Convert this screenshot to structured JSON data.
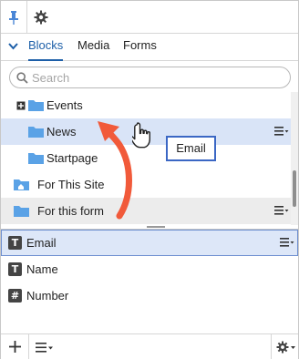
{
  "tabs": [
    {
      "label": "Blocks"
    },
    {
      "label": "Media"
    },
    {
      "label": "Forms"
    }
  ],
  "search": {
    "placeholder": "Search"
  },
  "tree": {
    "items": [
      {
        "label": "Events",
        "icon": "folder-icon",
        "expander": "plus-box-icon"
      },
      {
        "label": "News",
        "icon": "folder-icon"
      },
      {
        "label": "Startpage",
        "icon": "folder-icon"
      },
      {
        "label": "For This Site",
        "icon": "site-folder-icon"
      },
      {
        "label": "For this form",
        "icon": "folder-icon"
      }
    ]
  },
  "fields": {
    "items": [
      {
        "label": "Email",
        "icon": "text-field-icon",
        "glyph": "T"
      },
      {
        "label": "Name",
        "icon": "text-field-icon",
        "glyph": "T"
      },
      {
        "label": "Number",
        "icon": "number-field-icon",
        "glyph": "#"
      }
    ]
  },
  "drag_tooltip": {
    "label": "Email"
  },
  "colors": {
    "accent": "#1d5fa8",
    "folder": "#5aa2e6",
    "selection": "#d9e4f7",
    "arrow": "#f15a3a"
  }
}
